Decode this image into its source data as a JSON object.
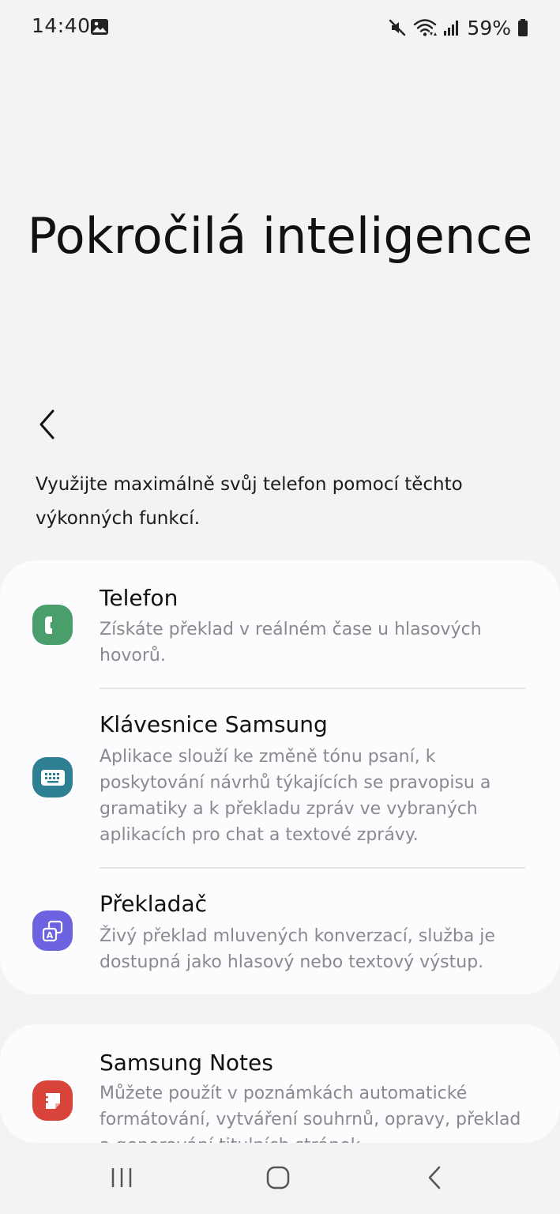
{
  "status_bar": {
    "time": "14:40",
    "battery": "59%",
    "icons": [
      "gallery-icon",
      "mute-icon",
      "wifi-icon",
      "signal-icon",
      "battery-icon"
    ]
  },
  "page": {
    "title": "Pokročilá inteligence",
    "intro": "Využijte maximálně svůj telefon pomocí těchto výkonných funkcí."
  },
  "features": [
    {
      "title": "Telefon",
      "description": "Získáte překlad v reálném čase u hlasových hovorů.",
      "icon": "phone-icon",
      "color": "#4a9e6b"
    },
    {
      "title": "Klávesnice Samsung",
      "description": "Aplikace slouží ke změně tónu psaní, k poskytování návrhů týkajících se pravopisu a gramatiky a k překladu zpráv ve vybraných aplikacích pro chat a textové zprávy.",
      "icon": "keyboard-icon",
      "color": "#2f7f93"
    },
    {
      "title": "Překladač",
      "description": "Živý překlad mluvených konverzací, služba je dostupná jako hlasový nebo textový výstup.",
      "icon": "translate-icon",
      "color": "#6d62e0"
    },
    {
      "title": "Samsung Notes",
      "description": "Můžete použít v poznámkách automatické formátování, vytváření souhrnů, opravy, překlad a generování titulních stránek.",
      "icon": "notes-icon",
      "color": "#d9443a"
    }
  ],
  "nav": {
    "icons": [
      "recent-apps-icon",
      "home-icon",
      "back-icon"
    ]
  }
}
